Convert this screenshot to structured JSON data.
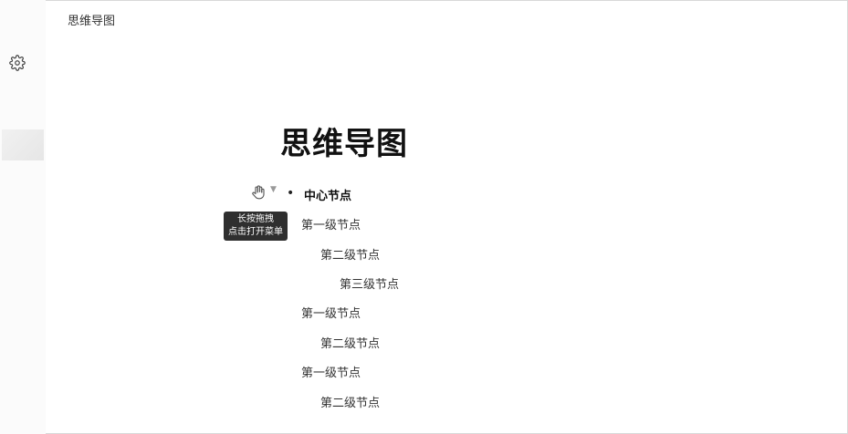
{
  "header": {
    "app_title": "思维导图"
  },
  "document": {
    "title": "思维导图"
  },
  "drag": {
    "tooltip_line1": "长按拖拽",
    "tooltip_line2": "点击打开菜单"
  },
  "outline": {
    "root": "中心节点",
    "nodes": [
      {
        "level": 1,
        "label": "第一级节点"
      },
      {
        "level": 2,
        "label": "第二级节点"
      },
      {
        "level": 3,
        "label": "第三级节点"
      },
      {
        "level": 1,
        "label": "第一级节点"
      },
      {
        "level": 2,
        "label": "第二级节点"
      },
      {
        "level": 1,
        "label": "第一级节点"
      },
      {
        "level": 2,
        "label": "第二级节点"
      }
    ]
  },
  "icons": {
    "settings": "gear-icon",
    "drag": "hand-icon"
  }
}
